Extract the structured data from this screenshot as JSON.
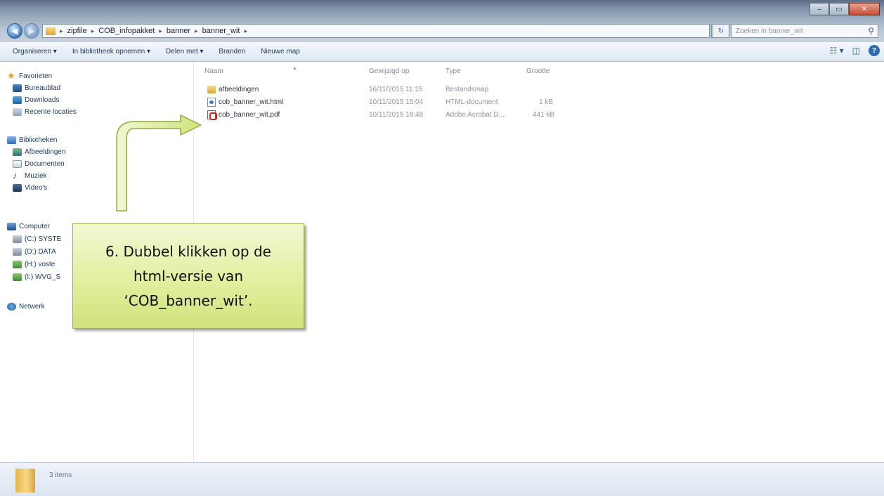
{
  "address": {
    "segments": [
      "zipfile",
      "COB_infopakket",
      "banner",
      "banner_wit"
    ],
    "search_placeholder": "Zoeken in banner_wit"
  },
  "toolbar": {
    "organize": "Organiseren ▾",
    "include_library": "In bibliotheek opnemen ▾",
    "share": "Delen met ▾",
    "burn": "Branden",
    "new_folder": "Nieuwe map"
  },
  "nav": {
    "favorites": "Favorieten",
    "desktop": "Bureaublad",
    "downloads": "Downloads",
    "recent": "Recente locaties",
    "libraries": "Bibliotheken",
    "pictures": "Afbeeldingen",
    "documents": "Documenten",
    "music": "Muziek",
    "videos": "Video's",
    "computer": "Computer",
    "drive_c": "(C:) SYSTE",
    "drive_d": "(D:) DATA",
    "drive_h": "(H:) voste",
    "drive_i": "(I:) WVG_S",
    "network": "Netwerk"
  },
  "columns": {
    "name": "Naam",
    "date": "Gewijzigd op",
    "type": "Type",
    "size": "Grootte"
  },
  "files": [
    {
      "name": "afbeeldingen",
      "date": "16/11/2015 11:15",
      "type": "Bestandsmap",
      "size": ""
    },
    {
      "name": "cob_banner_wit.html",
      "date": "10/11/2015 15:04",
      "type": "HTML-document",
      "size": "1 kB"
    },
    {
      "name": "cob_banner_wit.pdf",
      "date": "10/11/2015 18:48",
      "type": "Adobe Acrobat D...",
      "size": "441 kB"
    }
  ],
  "status": {
    "count": "3 items"
  },
  "annotation": {
    "text": "6. Dubbel klikken op  de\nhtml-versie van\n‘COB_banner_wit’.",
    "fill": "#e1ef9f",
    "border": "#9cb14b"
  }
}
